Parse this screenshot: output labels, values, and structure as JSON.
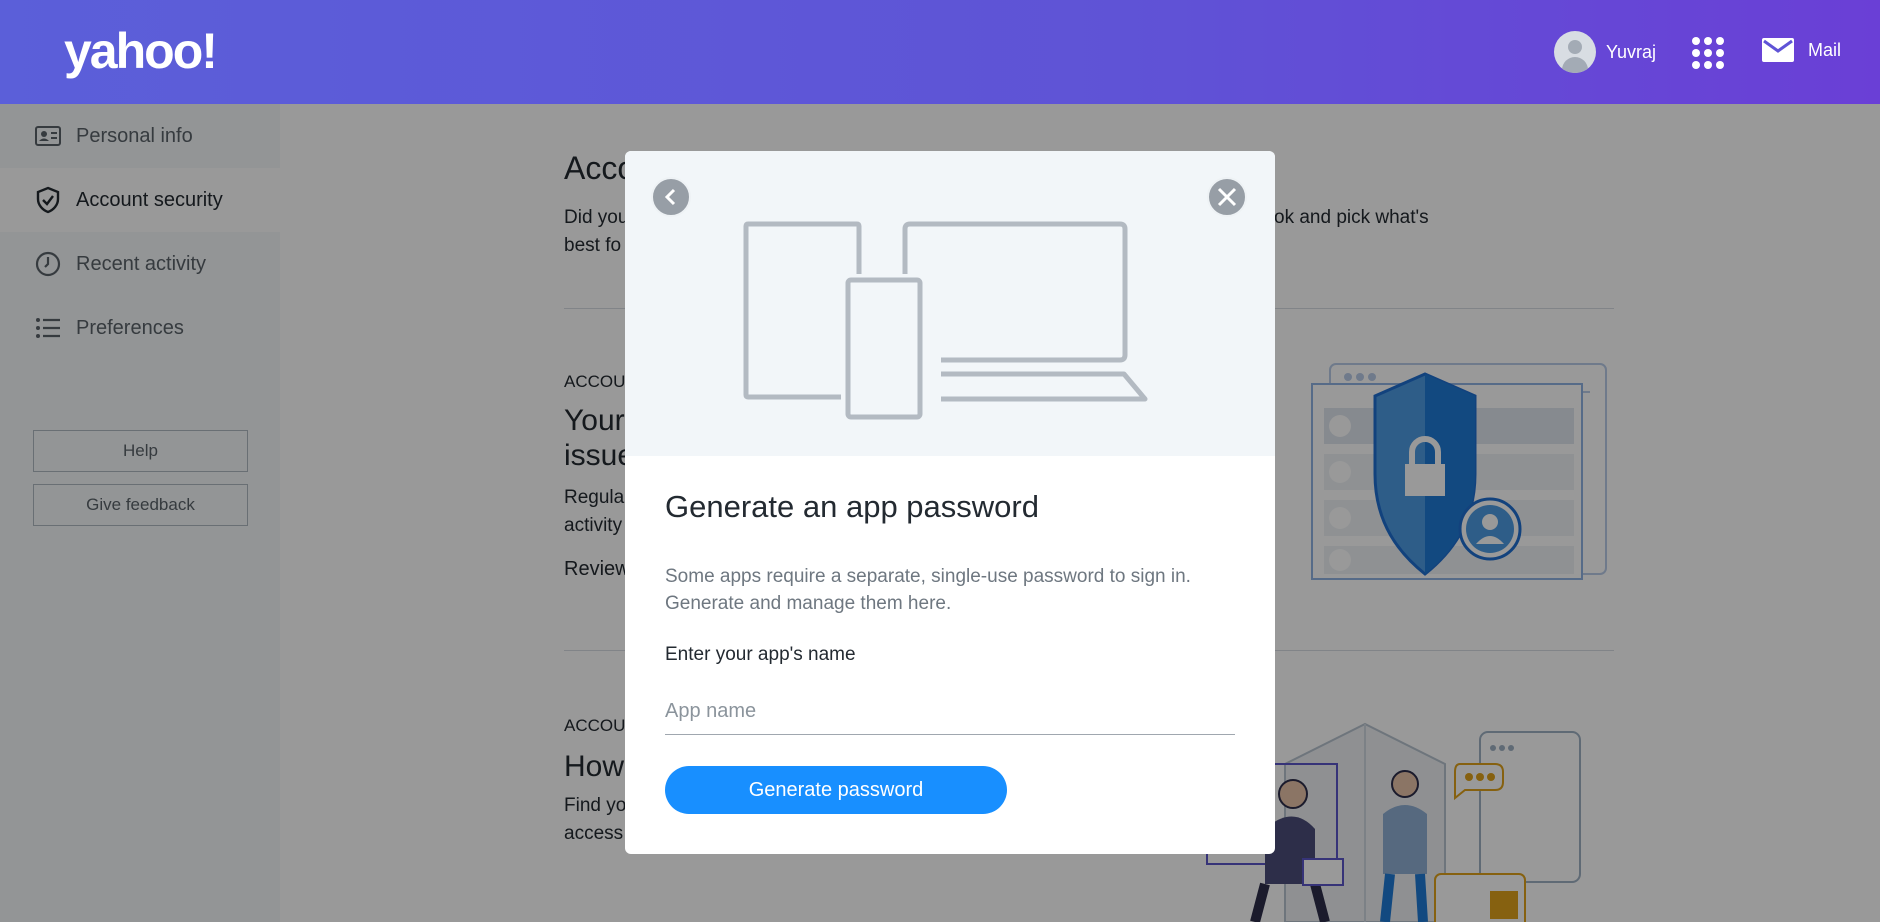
{
  "header": {
    "logo": "yahoo!",
    "user_name": "Yuvraj",
    "mail_label": "Mail"
  },
  "sidebar": {
    "items": [
      {
        "label": "Personal info",
        "icon": "id-card-icon"
      },
      {
        "label": "Account security",
        "icon": "shield-check-icon"
      },
      {
        "label": "Recent activity",
        "icon": "clock-icon"
      },
      {
        "label": "Preferences",
        "icon": "list-icon"
      }
    ],
    "help_label": "Help",
    "feedback_label": "Give feedback"
  },
  "main": {
    "title": "Acco",
    "intro_line1": "Did you",
    "intro_line1_end": "ok and pick what's",
    "intro_line2": "best fo",
    "section1": {
      "caps": "ACCOU",
      "heading1": "Your",
      "heading2": "issue",
      "body1": "Regula",
      "body2": "activity",
      "link": "Review"
    },
    "section2": {
      "caps": "ACCOU",
      "heading": "How",
      "body1": "Find yo",
      "body2": "access"
    }
  },
  "modal": {
    "title": "Generate an app password",
    "description": "Some apps require a separate, single-use password to sign in. Generate and manage them here.",
    "field_label": "Enter your app's name",
    "input_value": "",
    "input_placeholder": "App name",
    "button_label": "Generate password"
  },
  "colors": {
    "header_gradient_start": "#5b5fd9",
    "header_gradient_end": "#6a3fd6",
    "primary_button": "#188fff",
    "link": "#0f69ff",
    "overlay": "rgba(0,0,0,0.40)"
  }
}
